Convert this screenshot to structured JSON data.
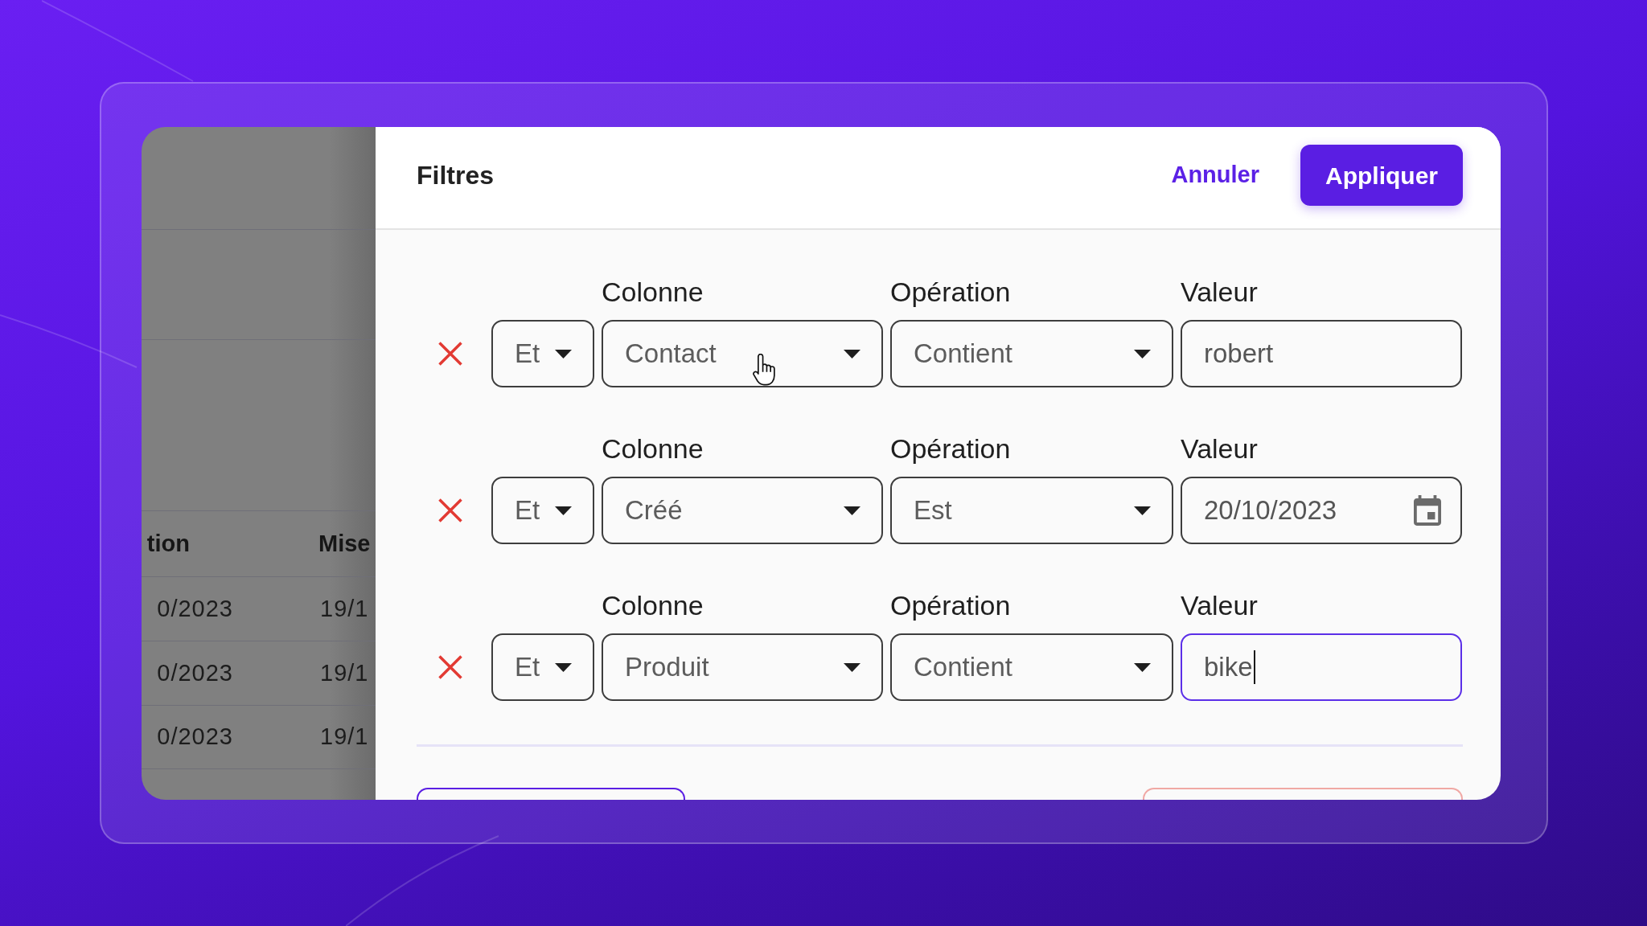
{
  "background_table": {
    "columns": [
      "tion",
      "Mise"
    ],
    "rows": [
      [
        "0/2023",
        "19/1"
      ],
      [
        "0/2023",
        "19/1"
      ],
      [
        "0/2023",
        "19/1"
      ]
    ]
  },
  "filter_panel": {
    "title": "Filtres",
    "cancel_button": "Annuler",
    "apply_button": "Appliquer",
    "filters": [
      {
        "conjunction": "Et",
        "column_label": "Colonne",
        "column": "Contact",
        "operation_label": "Opération",
        "operation": "Contient",
        "value_label": "Valeur",
        "kind": "text",
        "value": "robert",
        "focused": false
      },
      {
        "conjunction": "Et",
        "column_label": "Colonne",
        "column": "Créé",
        "operation_label": "Opération",
        "operation": "Est",
        "value_label": "Valeur",
        "kind": "date",
        "value": "20/10/2023",
        "focused": false
      },
      {
        "conjunction": "Et",
        "column_label": "Colonne",
        "column": "Produit",
        "operation_label": "Opération",
        "operation": "Contient",
        "value_label": "Valeur",
        "kind": "text",
        "value": "bike",
        "focused": true
      }
    ]
  }
}
